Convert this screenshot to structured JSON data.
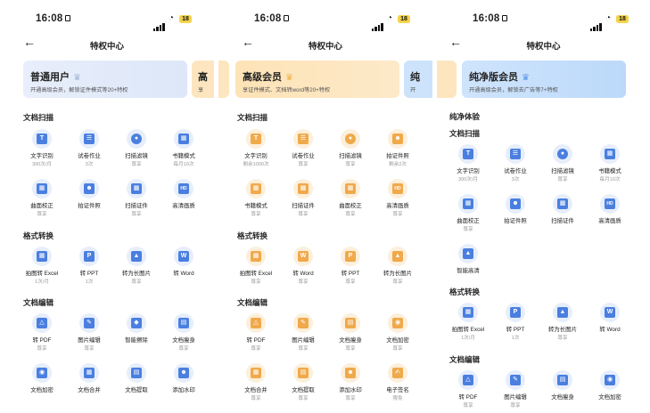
{
  "status_time": "16:08",
  "battery": "18",
  "nav_title": "特权中心",
  "screen1": {
    "card_title": "普通用户",
    "card_subtitle": "开通高级会员，解锁证件模式等20+特权",
    "next_card_title": "高",
    "next_card_subtitle": "享",
    "sec_scan": "文档扫描",
    "scan_items": [
      {
        "label": "文字识别",
        "sub": "300次/月"
      },
      {
        "label": "试卷作业",
        "sub": "3次"
      },
      {
        "label": "扫描滤镜",
        "sub": "尊享"
      },
      {
        "label": "书籍模式",
        "sub": "每月10次"
      },
      {
        "label": "曲面校正",
        "sub": "尊享"
      },
      {
        "label": "拍证件照",
        "sub": ""
      },
      {
        "label": "扫描证件",
        "sub": "尊享"
      },
      {
        "label": "高清画质",
        "sub": ""
      }
    ],
    "sec_format": "格式转换",
    "format_items": [
      {
        "label": "拍图转 Excel",
        "sub": "1次/月"
      },
      {
        "label": "转 PPT",
        "sub": "1次"
      },
      {
        "label": "转为长图片",
        "sub": "尊享"
      },
      {
        "label": "转 Word",
        "sub": ""
      }
    ],
    "sec_edit": "文档编辑",
    "edit_items": [
      {
        "label": "转 PDF",
        "sub": "尊享"
      },
      {
        "label": "图片编辑",
        "sub": "尊享"
      },
      {
        "label": "智能擦除",
        "sub": ""
      },
      {
        "label": "文档瘦身",
        "sub": "尊享"
      },
      {
        "label": "文档加密",
        "sub": ""
      },
      {
        "label": "文档合并",
        "sub": ""
      },
      {
        "label": "文档提取",
        "sub": ""
      },
      {
        "label": "添加水印",
        "sub": ""
      }
    ]
  },
  "screen2": {
    "card_title": "高级会员",
    "card_subtitle": "享证件模式、文档转word等20+特权",
    "next_card_title": "纯",
    "next_card_subtitle": "开",
    "sec_scan": "文档扫描",
    "scan_items": [
      {
        "label": "文字识别",
        "sub": "剩余1000次"
      },
      {
        "label": "试卷作业",
        "sub": "尊享"
      },
      {
        "label": "扫描滤镜",
        "sub": "尊享"
      },
      {
        "label": "拍证件照",
        "sub": "剩余2次"
      },
      {
        "label": "书籍模式",
        "sub": "尊享"
      },
      {
        "label": "扫描证件",
        "sub": "尊享"
      },
      {
        "label": "曲面校正",
        "sub": "尊享"
      },
      {
        "label": "高清画质",
        "sub": "尊享"
      }
    ],
    "sec_format": "格式转换",
    "format_items": [
      {
        "label": "拍图转 Excel",
        "sub": "尊享"
      },
      {
        "label": "转 Word",
        "sub": "尊享"
      },
      {
        "label": "转 PPT",
        "sub": "尊享"
      },
      {
        "label": "转为长图片",
        "sub": "尊享"
      }
    ],
    "sec_edit": "文档编辑",
    "edit_items": [
      {
        "label": "转 PDF",
        "sub": "尊享"
      },
      {
        "label": "图片编辑",
        "sub": "尊享"
      },
      {
        "label": "文档瘦身",
        "sub": "尊享"
      },
      {
        "label": "文档加密",
        "sub": "尊享"
      },
      {
        "label": "文档合并",
        "sub": "尊享"
      },
      {
        "label": "文档提取",
        "sub": "尊享"
      },
      {
        "label": "添加水印",
        "sub": "尊享"
      },
      {
        "label": "电子签名",
        "sub": "限免"
      }
    ]
  },
  "screen3": {
    "card_title": "纯净版会员",
    "card_subtitle": "开通高级会员，解锁去广告等7+特权",
    "sec_pure": "纯净体验",
    "sec_scan": "文档扫描",
    "scan_items": [
      {
        "label": "文字识别",
        "sub": "300次/月"
      },
      {
        "label": "试卷作业",
        "sub": "3次"
      },
      {
        "label": "扫描滤镜",
        "sub": "尊享"
      },
      {
        "label": "书籍模式",
        "sub": "每月10次"
      },
      {
        "label": "曲面校正",
        "sub": "尊享"
      },
      {
        "label": "拍证件照",
        "sub": ""
      },
      {
        "label": "扫描证件",
        "sub": ""
      },
      {
        "label": "高清画质",
        "sub": ""
      },
      {
        "label": "智能高清",
        "sub": ""
      }
    ],
    "sec_format": "格式转换",
    "format_items": [
      {
        "label": "拍图转 Excel",
        "sub": "1次/月"
      },
      {
        "label": "转 PPT",
        "sub": "1次"
      },
      {
        "label": "转为长图片",
        "sub": "尊享"
      },
      {
        "label": "转 Word",
        "sub": ""
      }
    ],
    "sec_edit": "文档编辑",
    "edit_items": [
      {
        "label": "转 PDF",
        "sub": "尊享"
      },
      {
        "label": "图片编辑",
        "sub": "尊享"
      },
      {
        "label": "文档瘦身",
        "sub": ""
      },
      {
        "label": "文档加密",
        "sub": ""
      }
    ]
  },
  "colors": {
    "blue_accent": "#4a7fe0",
    "orange_accent": "#f0a94b",
    "card_normal": "#e3ecfb",
    "card_premium": "#fde6bf",
    "card_pure": "#cde3fb"
  }
}
